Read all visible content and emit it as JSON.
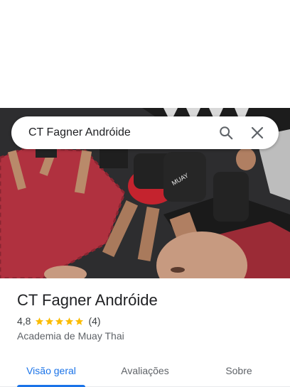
{
  "search": {
    "query": "CT Fagner Andróide"
  },
  "place": {
    "name": "CT Fagner Andróide",
    "rating": "4,8",
    "stars": 5,
    "review_count": "(4)",
    "category": "Academia de Muay Thai"
  },
  "tabs": [
    {
      "label": "Visão geral",
      "active": true
    },
    {
      "label": "Avaliações",
      "active": false
    },
    {
      "label": "Sobre",
      "active": false
    }
  ],
  "colors": {
    "accent": "#1a73e8",
    "star": "#fbbc04",
    "title": "#202124",
    "muted": "#5f6368"
  },
  "icons": [
    "search-icon",
    "close-icon",
    "star-icon"
  ]
}
